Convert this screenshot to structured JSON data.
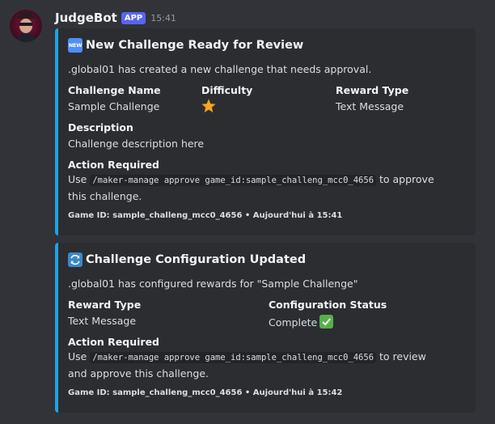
{
  "message": {
    "author": "JudgeBot",
    "badge": "APP",
    "time": "15:41"
  },
  "embed1": {
    "icon_label": "NEW",
    "title": "New Challenge Ready for Review",
    "description": ".global01 has created a new challenge that needs approval.",
    "fields": {
      "challenge_name_label": "Challenge Name",
      "challenge_name_value": "Sample Challenge",
      "difficulty_label": "Difficulty",
      "reward_type_label": "Reward Type",
      "reward_type_value": "Text Message",
      "description_label": "Description",
      "description_value": "Challenge description here",
      "action_label": "Action Required",
      "action_prefix": "Use ",
      "action_command": "/maker-manage approve game_id:sample_challeng_mcc0_4656",
      "action_suffix": " to approve this challenge."
    },
    "footer": "Game ID: sample_challeng_mcc0_4656 • Aujourd'hui à 15:41"
  },
  "embed2": {
    "title": "Challenge Configuration Updated",
    "description": ".global01 has configured rewards for \"Sample Challenge\"",
    "fields": {
      "reward_type_label": "Reward Type",
      "reward_type_value": "Text Message",
      "config_status_label": "Configuration Status",
      "config_status_value": "Complete",
      "action_label": "Action Required",
      "action_prefix": "Use ",
      "action_command": "/maker-manage approve game_id:sample_challeng_mcc0_4656",
      "action_suffix": " to review and approve this challenge."
    },
    "footer": "Game ID: sample_challeng_mcc0_4656 • Aujourd'hui à 15:42"
  },
  "colors": {
    "background": "#313338",
    "embed_background": "#2b2d31",
    "embed_accent": "#1fa3e5",
    "badge": "#5865f2"
  },
  "icons": {
    "difficulty": "star-icon",
    "embed1_title": "new-icon",
    "embed2_title": "refresh-icon",
    "status": "check-icon"
  }
}
